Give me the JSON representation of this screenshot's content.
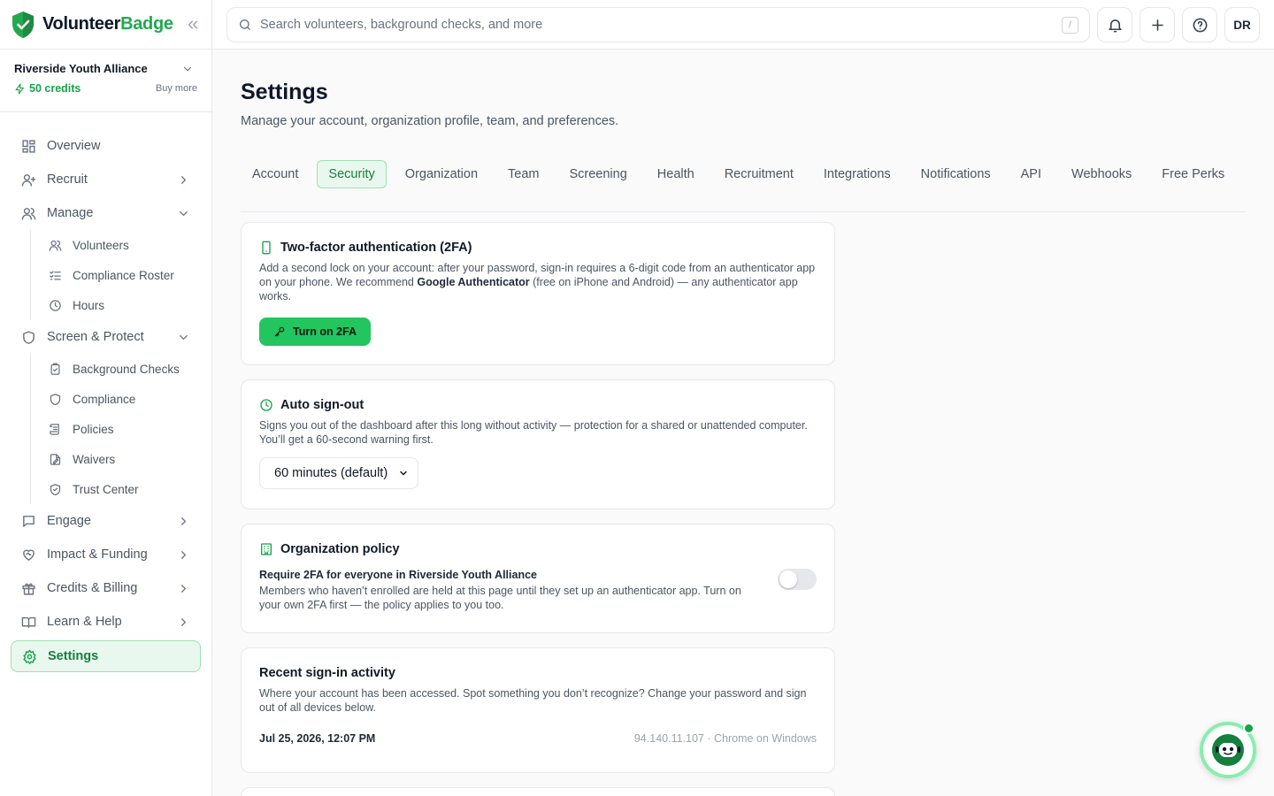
{
  "brand": {
    "name_a": "Volunteer",
    "name_b": "Badge"
  },
  "org": {
    "name": "Riverside Youth Alliance",
    "credits": "50 credits",
    "buy_more": "Buy more"
  },
  "nav": {
    "overview": "Overview",
    "recruit": "Recruit",
    "manage": "Manage",
    "manage_sub": [
      "Volunteers",
      "Compliance Roster",
      "Hours"
    ],
    "screen": "Screen & Protect",
    "screen_sub": [
      "Background Checks",
      "Compliance",
      "Policies",
      "Waivers",
      "Trust Center"
    ],
    "engage": "Engage",
    "impact": "Impact & Funding",
    "credits": "Credits & Billing",
    "learn": "Learn & Help",
    "settings": "Settings"
  },
  "search": {
    "placeholder": "Search volunteers, background checks, and more",
    "shortcut": "/"
  },
  "user": {
    "initials": "DR"
  },
  "page": {
    "title": "Settings",
    "subtitle": "Manage your account, organization profile, team, and preferences."
  },
  "tabs": [
    "Account",
    "Security",
    "Organization",
    "Team",
    "Screening",
    "Health",
    "Recruitment",
    "Integrations",
    "Notifications",
    "API",
    "Webhooks",
    "Free Perks"
  ],
  "twofa": {
    "title": "Two-factor authentication (2FA)",
    "desc_a": "Add a second lock on your account: after your password, sign-in requires a 6-digit code from an authenticator app on your phone. We recommend ",
    "desc_b": "Google Authenticator",
    "desc_c": " (free on iPhone and Android) — any authenticator app works.",
    "button": "Turn on 2FA"
  },
  "autosignout": {
    "title": "Auto sign-out",
    "desc": "Signs you out of the dashboard after this long without activity — protection for a shared or unattended computer. You’ll get a 60-second warning first.",
    "value": "60 minutes (default)"
  },
  "policy": {
    "title": "Organization policy",
    "setting_title": "Require 2FA for everyone in Riverside Youth Alliance",
    "setting_desc": "Members who haven’t enrolled are held at this page until they set up an authenticator app. Turn on your own 2FA first — the policy applies to you too.",
    "enabled": false
  },
  "activity": {
    "title": "Recent sign-in activity",
    "desc": "Where your account has been accessed. Spot something you don’t recognize? Change your password and sign out of all devices below.",
    "rows": [
      {
        "date": "Jul 25, 2026, 12:07 PM",
        "meta": "94.140.11.107 · Chrome on Windows"
      }
    ]
  },
  "colors": {
    "accent": "#22c55e",
    "accent_dark": "#16a34a",
    "active_bg": "#e9f8ee"
  }
}
